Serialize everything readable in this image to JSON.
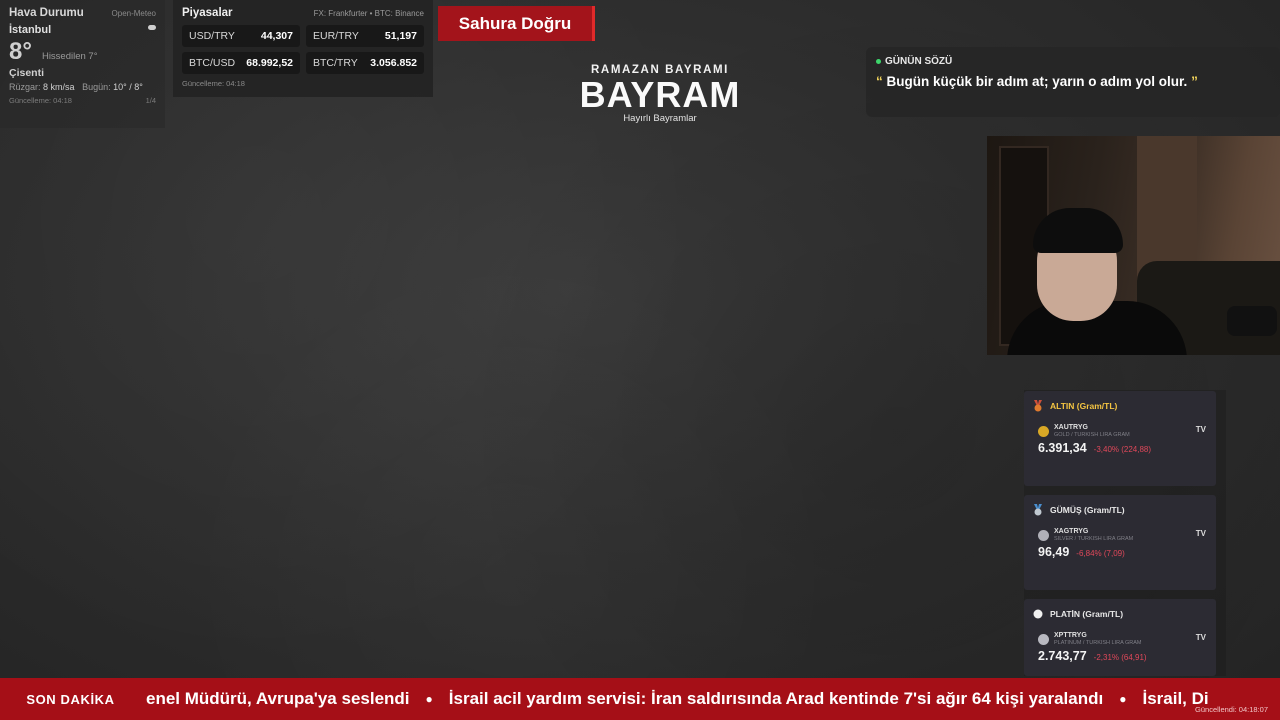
{
  "weather": {
    "title": "Hava Durumu",
    "source": "Open-Meteo",
    "city": "İstanbul",
    "temp": "8°",
    "feels": "Hissedilen 7°",
    "condition": "Çisenti",
    "wind_label": "Rüzgar",
    "wind_value": "8 km/sa",
    "today_label": "Bugün",
    "today_value": "10° / 8°",
    "updated": "Güncelleme: 04:18",
    "page": "1/4"
  },
  "markets": {
    "title": "Piyasalar",
    "source": "FX: Frankfurter • BTC: Binance",
    "items": [
      {
        "symbol": "USD/TRY",
        "value": "44,307"
      },
      {
        "symbol": "EUR/TRY",
        "value": "51,197"
      },
      {
        "symbol": "BTC/USD",
        "value": "68.992,52"
      },
      {
        "symbol": "BTC/TRY",
        "value": "3.056.852"
      }
    ],
    "updated": "Güncelleme: 04:18"
  },
  "sahura": "Sahura Doğru",
  "bayram": {
    "sub": "RAMAZAN BAYRAMI",
    "big": "BAYRAM",
    "small": "Hayırlı Bayramlar"
  },
  "quote": {
    "label": "GÜNÜN SÖZÜ",
    "open": "“",
    "text": "Bugün küçük bir adım at; yarın o adım yol olur.",
    "close": "”"
  },
  "metals": [
    {
      "title": "ALTIN (Gram/TL)",
      "title_color": "#f5c542",
      "medal_color": "#e07a2e",
      "coin_color": "#d9a826",
      "symbol": "XAUTRYG",
      "desc": "GOLD / TURKISH LIRA GRAM",
      "badge": "TV",
      "price": "6.391,34",
      "change": "-3,40% (224,88)"
    },
    {
      "title": "GÜMÜŞ (Gram/TL)",
      "title_color": "#e8e8e8",
      "medal_color": "#7fb2d9",
      "coin_color": "#b0b0b8",
      "symbol": "XAGTRYG",
      "desc": "SILVER / TURKISH LIRA GRAM",
      "badge": "TV",
      "price": "96,49",
      "change": "-6,84% (7,09)"
    },
    {
      "title": "PLATİN (Gram/TL)",
      "title_color": "#e8e8e8",
      "medal_color": "#f0f0f0",
      "coin_color": "#b8b8c0",
      "symbol": "XPTTRYG",
      "desc": "PLATINUM / TURKISH LIRA GRAM",
      "badge": "TV",
      "price": "2.743,77",
      "change": "-2,31% (64,91)"
    }
  ],
  "ticker": {
    "label": "SON DAKİKA",
    "items": [
      "enel Müdürü, Avrupa'ya seslendi",
      "İsrail acil yardım servisi: İran saldırısında Arad kentinde 7'si ağır 64 kişi yaralandı",
      "İsrail, Di"
    ],
    "updated": "Güncellendi: 04:18:07"
  }
}
